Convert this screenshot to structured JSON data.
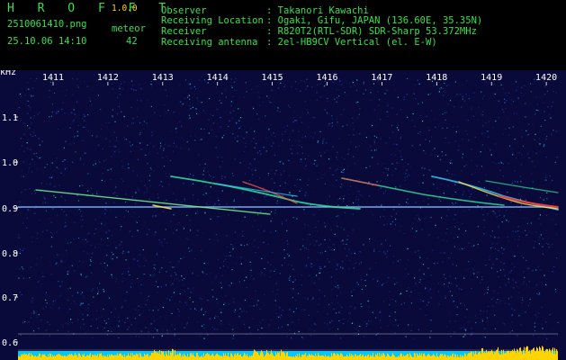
{
  "header": {
    "app_name": "H R O F F T",
    "version": "1.0.0",
    "filename": "2510061410.png",
    "timestamp": "25.10.06 14:10",
    "meteor_label": "meteor",
    "meteor_count": "42",
    "info_labels": [
      "Observer",
      "Receiving Location",
      "Receiver",
      "Receiving antenna"
    ],
    "info_values": [
      ": Takanori Kawachi",
      ": Ogaki, Gifu, JAPAN (136.60E, 35.35N)",
      ": R820T2(RTL-SDR) SDR-Sharp 53.372MHz",
      ": 2el-HB9CV Vertical (el. E-W)"
    ]
  },
  "spectrogram": {
    "unit_label": "kHz",
    "time_ticks": [
      "1411",
      "1412",
      "1413",
      "1414",
      "1415",
      "1416",
      "1417",
      "1418",
      "1419",
      "1420"
    ],
    "freq_ticks": [
      "1.1",
      "1.0",
      "0.9",
      "0.8",
      "0.7",
      "0.6"
    ],
    "colors": {
      "background": "#0a0a3a",
      "tick": "#ffffff",
      "level_bar": "#ffd400",
      "level_base": "#00c8ff"
    }
  }
}
